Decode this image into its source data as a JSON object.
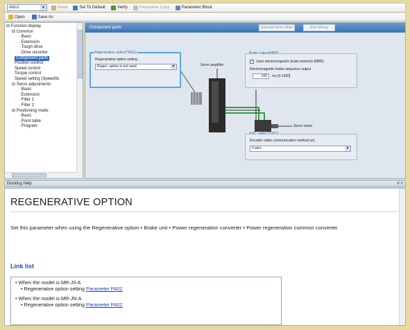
{
  "toolbar": {
    "axis_select": "Axis1",
    "read": "Read",
    "set_to_default": "Set To Default",
    "verify": "Verify",
    "parameter_copy": "Parameter Copy",
    "parameter_block": "Parameter Block",
    "open": "Open",
    "save_as": "Save As"
  },
  "tree": [
    {
      "label": "Function display",
      "prefix": "⊟ "
    },
    {
      "label": "Common",
      "prefix": "⊟ "
    },
    {
      "label": "Basic",
      "prefix": "· "
    },
    {
      "label": "Extension",
      "prefix": "· "
    },
    {
      "label": "Tough drive",
      "prefix": "· "
    },
    {
      "label": "Drive recorder",
      "prefix": "· "
    },
    {
      "label": "Component parts",
      "prefix": "",
      "selected": true
    },
    {
      "label": "Position control",
      "prefix": ""
    },
    {
      "label": "Speed control",
      "prefix": ""
    },
    {
      "label": "Torque control",
      "prefix": ""
    },
    {
      "label": "Speed setting (Speed/to",
      "prefix": ""
    },
    {
      "label": "Servo adjustments",
      "prefix": "⊟ "
    },
    {
      "label": "Basic",
      "prefix": "· "
    },
    {
      "label": "Extension",
      "prefix": "· "
    },
    {
      "label": "Filter 1",
      "prefix": "· "
    },
    {
      "label": "Filter 2",
      "prefix": "· "
    },
    {
      "label": "Positioning mode",
      "prefix": "⊟ "
    },
    {
      "label": "Basic",
      "prefix": "· "
    },
    {
      "label": "Point table",
      "prefix": "· "
    },
    {
      "label": "Program",
      "prefix": "· "
    }
  ],
  "panel": {
    "title": "Component parts",
    "selected_items_write": "Selected Items Write",
    "axis_writing": "Axis Writing",
    "regen_group": "Regenerative option(*REG)",
    "regen_label": "Regenerative option setting",
    "regen_value": "Regen. option is not used",
    "servo_amplifier": "Servo amplifier",
    "brake_group": "Brake output(MBR)",
    "brake_check_label": "Uses electromagnetic brake interlock (MBR)",
    "brake_seq_label": "Electromagnetic brake sequence output",
    "brake_seq_value": "100",
    "brake_seq_unit": "ms [0-1000]",
    "servo_motor": "Servo motor",
    "enc_group": "ENC cable(*COP1)",
    "enc_label": "Encoder cable communication method sel.",
    "enc_value": "2-wire"
  },
  "docking": {
    "title": "Docking Help",
    "pin": "# ×"
  },
  "help": {
    "heading": "REGENERATIVE OPTION",
    "description": "Set this parameter when using the Regenerative option • Brake unit • Power regeneration converter • Power regeneration common converter.",
    "link_list_title": "Link list",
    "links": [
      {
        "model": "When the model is MR-J3-A",
        "setting": "Regenerative option setting",
        "param": "Parameter PA02"
      },
      {
        "model": "When the model is MR-JN-A",
        "setting": "Regenerative option setting",
        "param": "Parameter PA02"
      }
    ]
  },
  "colors": {
    "selection": "#3367c6",
    "header_blue": "#3a73b6",
    "link_blue": "#1a3fb8",
    "wire_green": "#2f9e3d"
  }
}
